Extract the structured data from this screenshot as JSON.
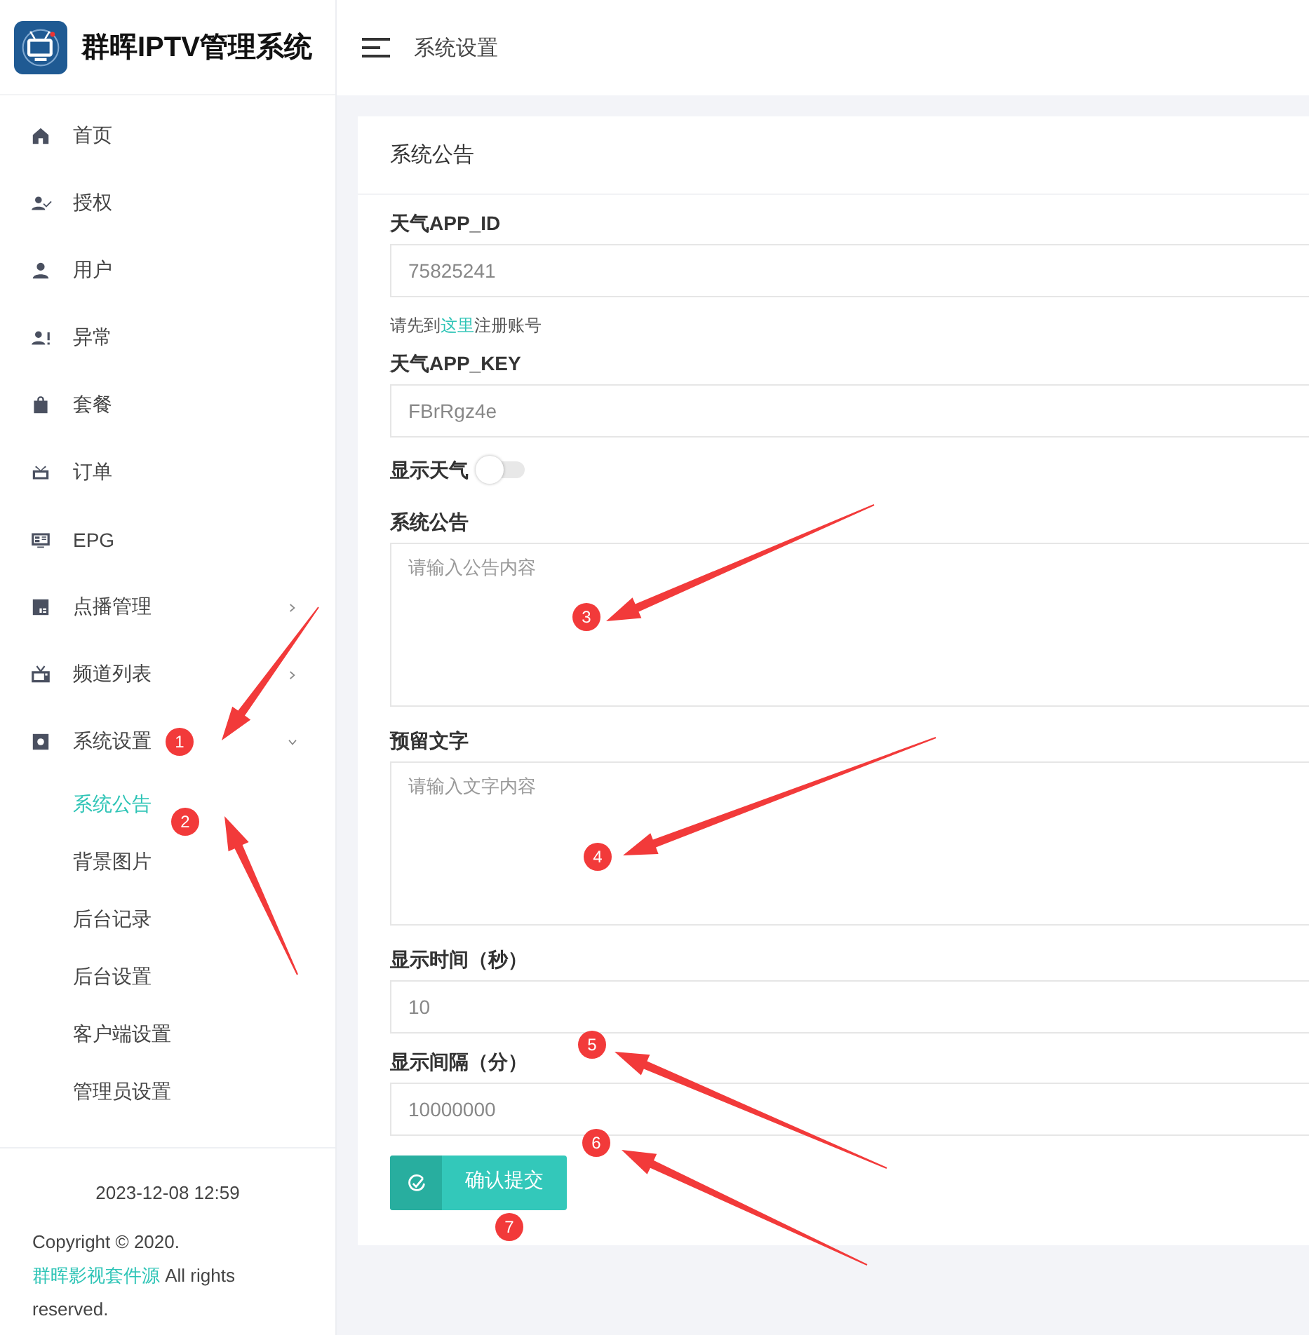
{
  "app": {
    "title": "群晖IPTV管理系统"
  },
  "nav": [
    {
      "label": "首页"
    },
    {
      "label": "授权"
    },
    {
      "label": "用户"
    },
    {
      "label": "异常"
    },
    {
      "label": "套餐"
    },
    {
      "label": "订单"
    },
    {
      "label": "EPG"
    },
    {
      "label": "点播管理",
      "expanded": false
    },
    {
      "label": "频道列表",
      "expanded": false
    },
    {
      "label": "系统设置",
      "expanded": true,
      "children": [
        {
          "label": "系统公告",
          "selected": true
        },
        {
          "label": "背景图片",
          "selected": false
        },
        {
          "label": "后台记录",
          "selected": false
        },
        {
          "label": "后台设置",
          "selected": false
        },
        {
          "label": "客户端设置",
          "selected": false
        },
        {
          "label": "管理员设置",
          "selected": false
        }
      ]
    }
  ],
  "footer": {
    "datetime": "2023-12-08 12:59",
    "copyright_before": "Copyright © 2020. ",
    "copyright_link": "群晖影视套件源",
    "copyright_after": " All rights reserved."
  },
  "header": {
    "title": "系统设置"
  },
  "card": {
    "title": "系统公告",
    "fields": [
      {
        "kind": "input",
        "label": "天气APP_ID",
        "value": "75825241",
        "help_before": "请先到",
        "help_link": "这里",
        "help_after": "注册账号"
      },
      {
        "kind": "input",
        "label": "天气APP_KEY",
        "value": "FBrRgz4e"
      },
      {
        "kind": "switch",
        "label": "显示天气",
        "on": false
      },
      {
        "kind": "textarea",
        "label": "系统公告",
        "placeholder": "请输入公告内容"
      },
      {
        "kind": "textarea",
        "label": "预留文字",
        "placeholder": "请输入文字内容"
      },
      {
        "kind": "input",
        "label": "显示时间（秒）",
        "value": "10"
      },
      {
        "kind": "input",
        "label": "显示间隔（分）",
        "value": "10000000"
      }
    ],
    "submit": "确认提交"
  },
  "annotations": [
    {
      "number": "1"
    },
    {
      "number": "2"
    },
    {
      "number": "3"
    },
    {
      "number": "4"
    },
    {
      "number": "5"
    },
    {
      "number": "6"
    },
    {
      "number": "7"
    }
  ]
}
